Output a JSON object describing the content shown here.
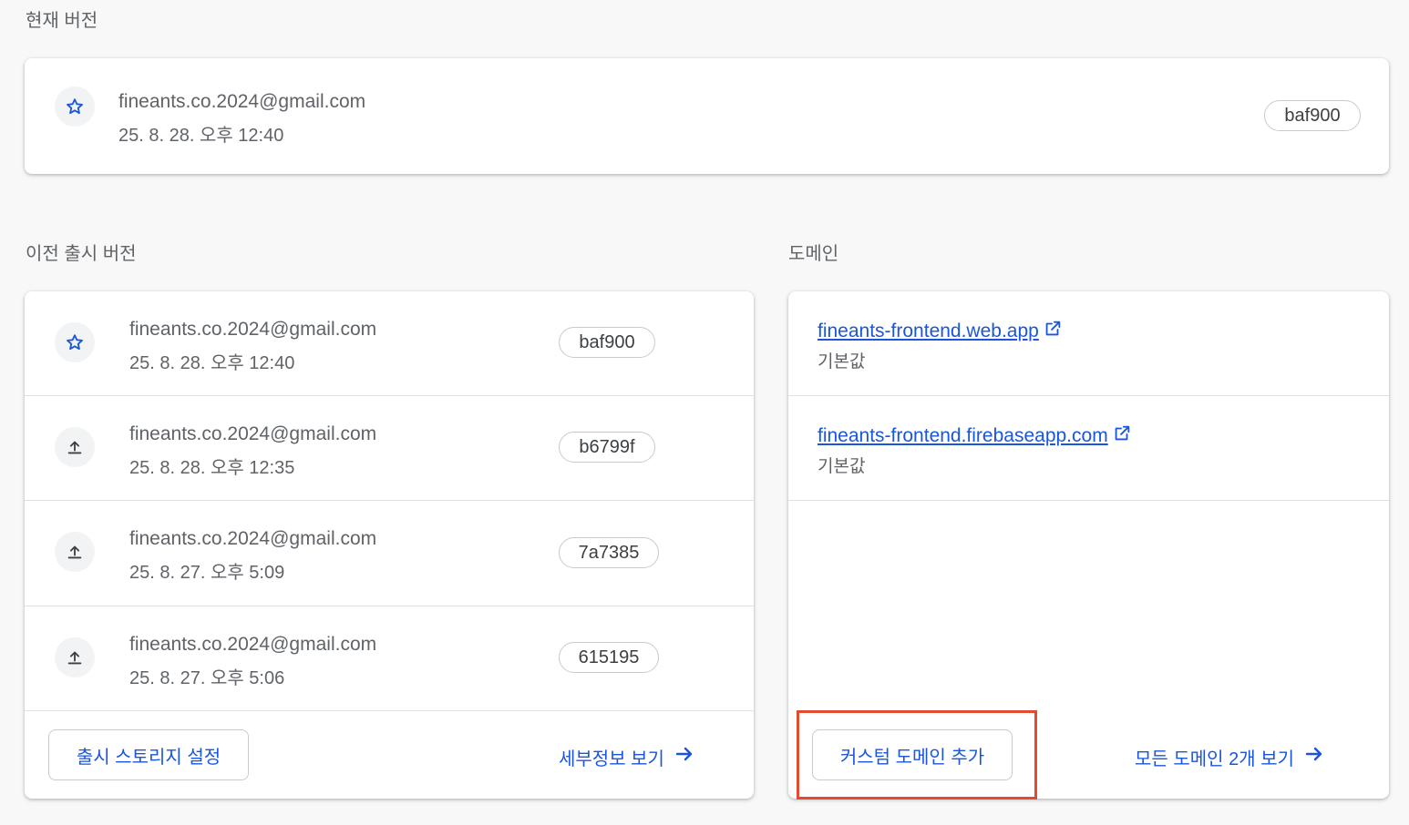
{
  "current_version": {
    "section_label": "현재 버전",
    "release": {
      "email": "fineants.co.2024@gmail.com",
      "date": "25. 8. 28. 오후 12:40",
      "version": "baf900",
      "icon": "star-icon"
    }
  },
  "previous_releases": {
    "section_label": "이전 출시 버전",
    "items": [
      {
        "email": "fineants.co.2024@gmail.com",
        "date": "25. 8. 28. 오후 12:40",
        "version": "baf900",
        "icon": "star-icon"
      },
      {
        "email": "fineants.co.2024@gmail.com",
        "date": "25. 8. 28. 오후 12:35",
        "version": "b6799f",
        "icon": "upload-icon"
      },
      {
        "email": "fineants.co.2024@gmail.com",
        "date": "25. 8. 27. 오후 5:09",
        "version": "7a7385",
        "icon": "upload-icon"
      },
      {
        "email": "fineants.co.2024@gmail.com",
        "date": "25. 8. 27. 오후 5:06",
        "version": "615195",
        "icon": "upload-icon"
      }
    ],
    "storage_button": "출시 스토리지 설정",
    "details_button": "세부정보 보기"
  },
  "domains": {
    "section_label": "도메인",
    "items": [
      {
        "url": "fineants-frontend.web.app",
        "tag": "기본값"
      },
      {
        "url": "fineants-frontend.firebaseapp.com",
        "tag": "기본값"
      }
    ],
    "add_custom_button": "커스텀 도메인 추가",
    "view_all_button": "모든 도메인 2개 보기"
  },
  "colors": {
    "accent": "#1a56db",
    "highlight": "#e24b2d"
  }
}
